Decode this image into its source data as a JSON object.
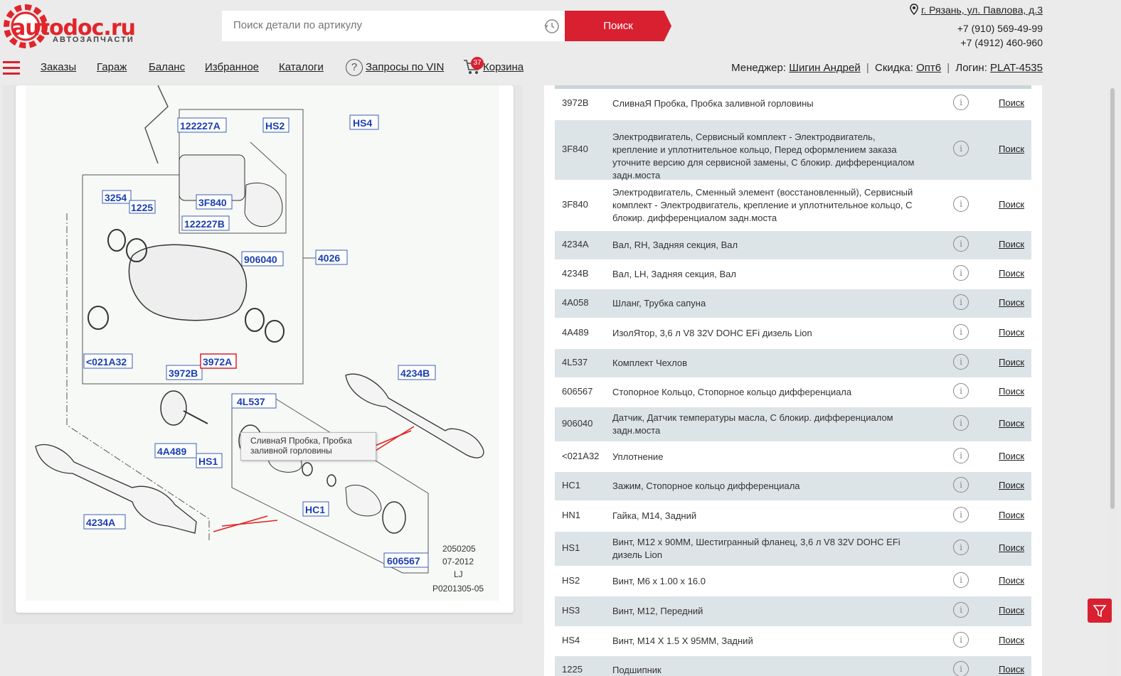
{
  "header": {
    "logo_text": "autodoc.ru",
    "logo_sub": "АВТОЗАПЧАСТИ",
    "search_placeholder": "Поиск детали по артикулу",
    "search_button": "Поиск",
    "address": "г. Рязань, ул. Павлова, д.3",
    "phone1": "+7 (910) 569-49-99",
    "phone2": "+7 (4912) 460-960"
  },
  "nav": {
    "orders": "Заказы",
    "garage": "Гараж",
    "balance": "Баланс",
    "favorites": "Избранное",
    "catalogs": "Каталоги",
    "vin": "Запросы по VIN",
    "cart": "Корзина",
    "cart_count": "37"
  },
  "user": {
    "manager_label": "Менеджер:",
    "manager_name": "Шигин Андрей",
    "discount_label": "Скидка:",
    "discount_value": "Опт6",
    "login_label": "Логин:",
    "login_value": "PLAT-4535"
  },
  "diagram": {
    "labels": [
      "122227A",
      "HS2",
      "HS4",
      "3254",
      "1225",
      "3F840",
      "122227B",
      "906040",
      "4026",
      "<021A32",
      "3972B",
      "3972A",
      "4234B",
      "4L537",
      "4A489",
      "HS1",
      "HC1",
      "4234A",
      "606567"
    ],
    "footer1": "2050205",
    "footer2": "07-2012",
    "footer3": "LJ",
    "footer4": "P0201305-05",
    "tooltip": "СливнаЯ Пробка, Пробка заливной горловины"
  },
  "parts": {
    "search_label": "Поиск",
    "info_icon": "i",
    "rows": [
      {
        "code": "3972B",
        "desc": "СливнаЯ Пробка, Пробка заливной горловины"
      },
      {
        "code": "3F840",
        "desc": "Электродвигатель, Сервисный комплект - Электродвигатель, крепление и уплотнительное кольцо, Перед оформлением заказа уточните версию для сервисной замены, С блокир. дифференциалом задн.моста"
      },
      {
        "code": "3F840",
        "desc": "Электродвигатель, Сменный элемент (восстановленный), Сервисный комплект - Электродвигатель, крепление и уплотнительное кольцо, С блокир. дифференциалом задн.моста"
      },
      {
        "code": "4234A",
        "desc": "Вал, RH, Задняя секция, Вал"
      },
      {
        "code": "4234B",
        "desc": "Вал, LH, Задняя секция, Вал"
      },
      {
        "code": "4A058",
        "desc": "Шланг, Трубка сапуна"
      },
      {
        "code": "4A489",
        "desc": "ИзолЯтор, 3,6 л V8 32V DOHC EFi дизель Lion"
      },
      {
        "code": "4L537",
        "desc": "Комплект Чехлов"
      },
      {
        "code": "606567",
        "desc": "Стопорное Кольцо, Стопорное кольцо дифференциала"
      },
      {
        "code": "906040",
        "desc": "Датчик, Датчик температуры масла, С блокир. дифференциалом задн.моста"
      },
      {
        "code": "<021A32",
        "desc": "Уплотнение"
      },
      {
        "code": "HC1",
        "desc": "Зажим, Стопорное кольцо дифференциала"
      },
      {
        "code": "HN1",
        "desc": "Гайка, М14, Задний"
      },
      {
        "code": "HS1",
        "desc": "Винт, M12 x 90MM, Шестигранный фланец, 3,6 л V8 32V DOHC EFi дизель Lion"
      },
      {
        "code": "HS2",
        "desc": "Винт, M6 x 1.00 x 16.0"
      },
      {
        "code": "HS3",
        "desc": "Винт, M12, Передний"
      },
      {
        "code": "HS4",
        "desc": "Винт, M14 X 1.5 X 95MM, Задний"
      },
      {
        "code": "1225",
        "desc": "Подшипник"
      }
    ]
  },
  "colors": {
    "brand": "#d92030",
    "row_shade": "#dde4e7",
    "label_blue": "#1a3fb0"
  }
}
